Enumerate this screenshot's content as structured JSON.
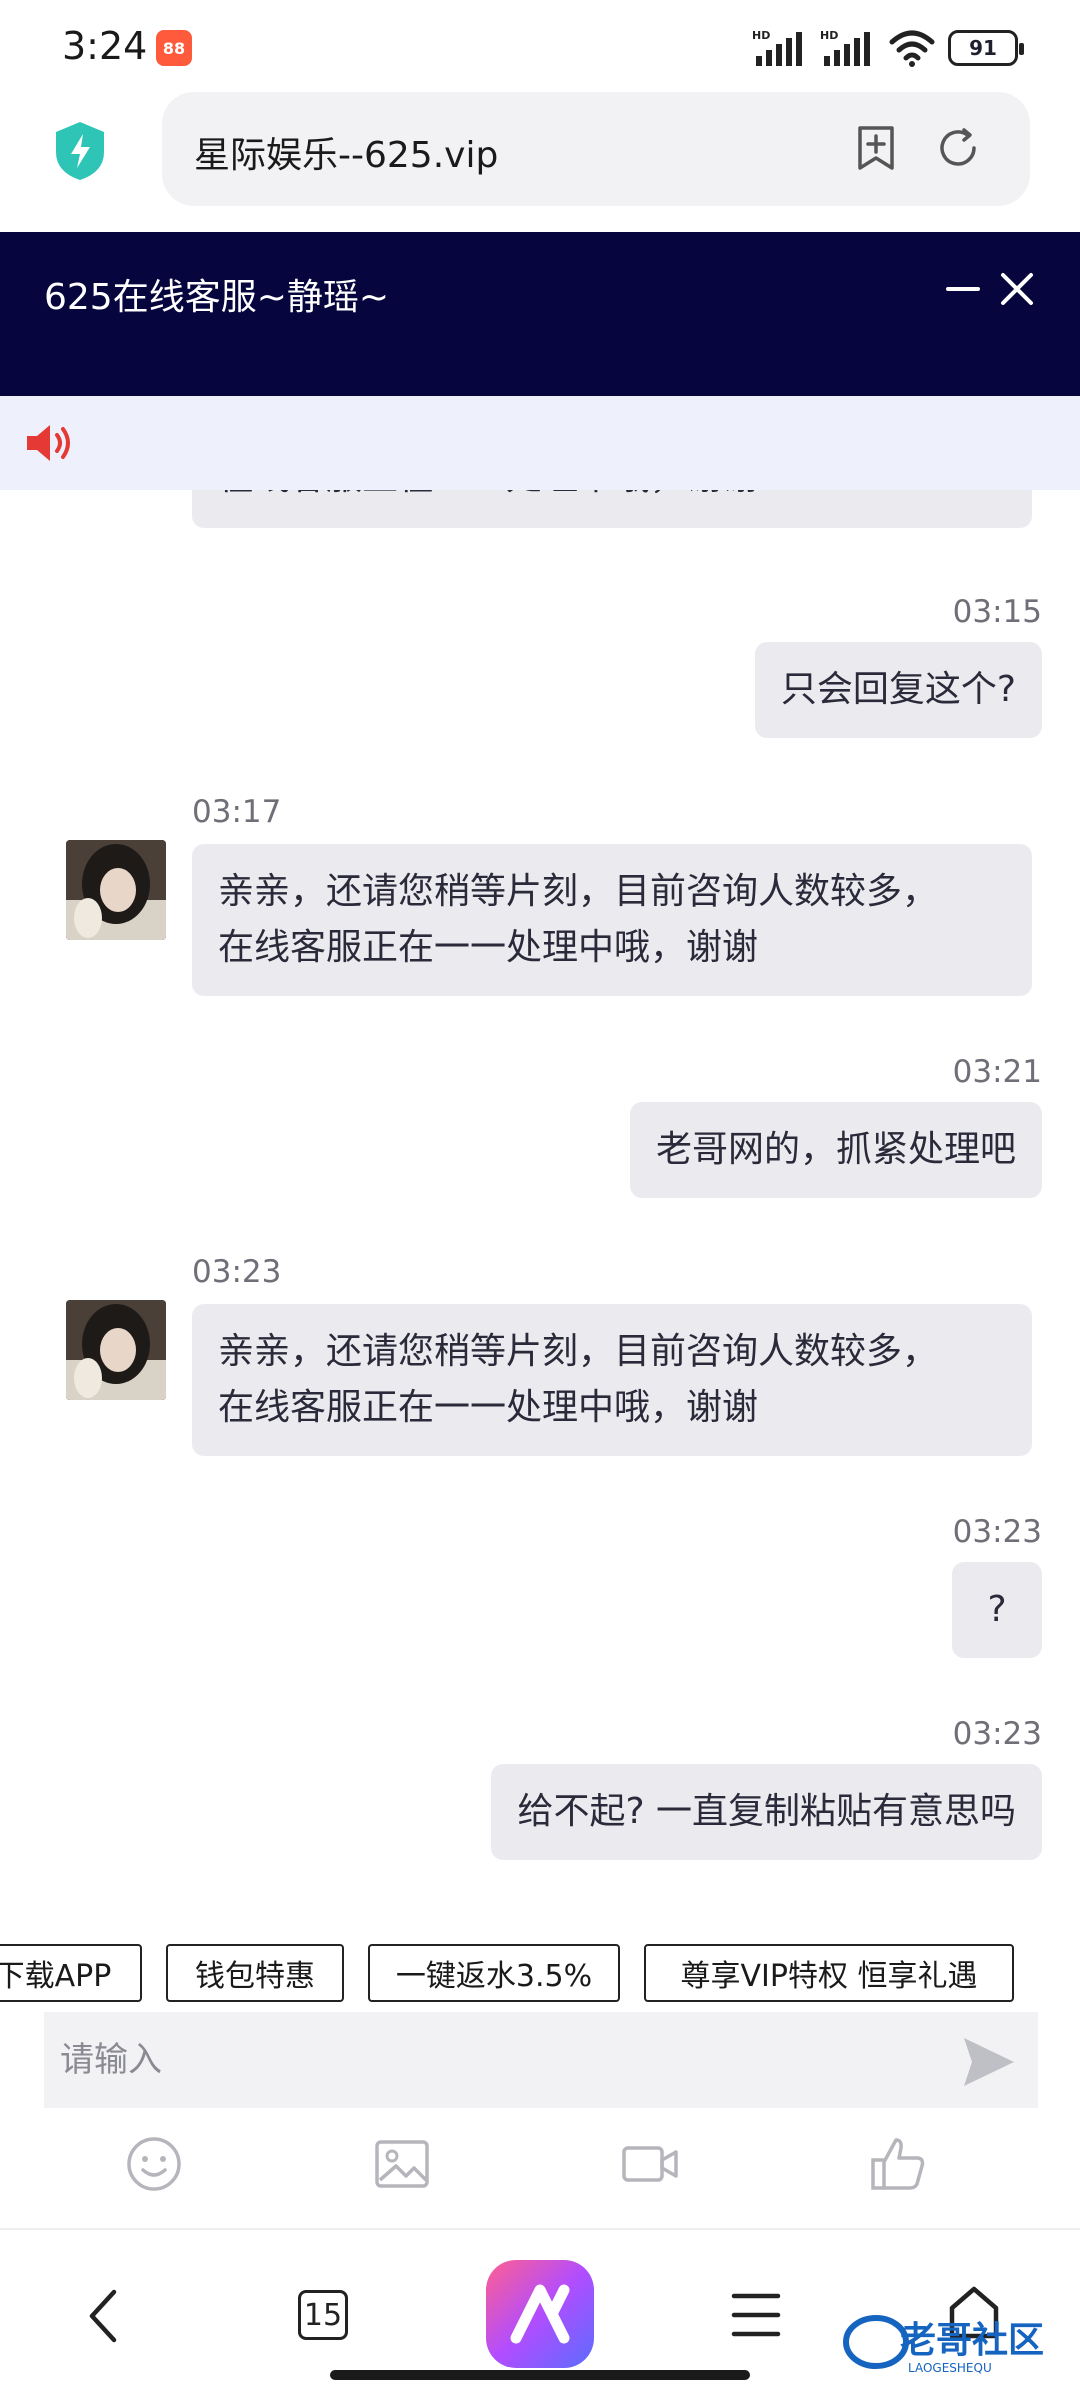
{
  "status_bar": {
    "time": "3:24",
    "app_badge": "88",
    "signal_1_label": "HD",
    "signal_2_label": "HD",
    "battery": "91"
  },
  "browser": {
    "url": "星际娱乐--625.vip"
  },
  "chat": {
    "title": "625在线客服~静瑶~",
    "messages": [
      {
        "side": "agent",
        "text": "在线客服正在一一处理中哦，谢谢"
      },
      {
        "side": "user",
        "time": "03:15",
        "text": "只会回复这个?"
      },
      {
        "side": "agent",
        "time": "03:17",
        "line1": "亲亲，还请您稍等片刻，目前咨询人数较多，",
        "line2": "在线客服正在一一处理中哦，谢谢"
      },
      {
        "side": "user",
        "time": "03:21",
        "text": "老哥网的，抓紧处理吧"
      },
      {
        "side": "agent",
        "time": "03:23",
        "line1": "亲亲，还请您稍等片刻，目前咨询人数较多，",
        "line2": "在线客服正在一一处理中哦，谢谢"
      },
      {
        "side": "user",
        "time": "03:23",
        "text": "?"
      },
      {
        "side": "user",
        "time": "03:23",
        "text": "给不起? 一直复制粘贴有意思吗"
      }
    ]
  },
  "quick_buttons": [
    "下载APP",
    "钱包特惠",
    "一键返水3.5%",
    "尊享VIP特权 恒享礼遇"
  ],
  "input": {
    "placeholder": "请输入"
  },
  "toolbar": {
    "icons": [
      "emoji-icon",
      "image-icon",
      "video-icon",
      "thumbs-up-icon"
    ]
  },
  "bottom_nav": {
    "tab_count": "15",
    "watermark": "老哥社区",
    "watermark_sub": "LAOGESHEQU"
  },
  "colors": {
    "header_bg": "#06053d",
    "notice_bg": "#eef1fb",
    "bubble_bg": "#ebebef",
    "speaker": "#e53935"
  }
}
